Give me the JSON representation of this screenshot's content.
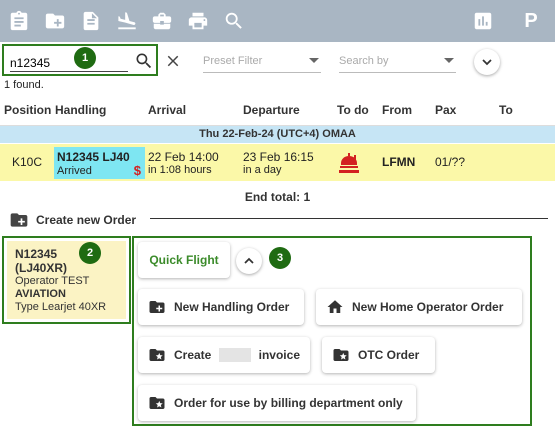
{
  "toolbar": {
    "icons": [
      "clipboard-icon",
      "add-folder-icon",
      "document-icon",
      "flight-landing-icon",
      "briefcase-icon",
      "print-icon",
      "search-icon",
      "bar-chart-icon",
      "parking-icon"
    ],
    "parking_label": "P"
  },
  "search": {
    "value": "n12345",
    "badge": "1"
  },
  "filters": {
    "preset_placeholder": "Preset Filter",
    "search_by_placeholder": "Search by"
  },
  "result": {
    "found_text": "1 found."
  },
  "table": {
    "headers": {
      "position": "Position",
      "handling": "Handling",
      "arrival": "Arrival",
      "departure": "Departure",
      "todo": "To do",
      "from": "From",
      "pax": "Pax",
      "to": "To"
    },
    "date_group": "Thu 22-Feb-24 (UTC+4) OMAA",
    "row": {
      "position": "K10C",
      "handling_title": "N12345 LJ40",
      "handling_status": "Arrived",
      "handling_flag": "$",
      "arrival_time": "22 Feb 14:00",
      "arrival_rel": "in 1:08 hours",
      "departure_time": "23 Feb 16:15",
      "departure_rel": "in a day",
      "from": "LFMN",
      "pax": "01/??"
    },
    "end_total": "End total: 1"
  },
  "create_order": {
    "label": "Create new Order"
  },
  "aircraft": {
    "badge": "2",
    "reg": "N12345",
    "type_code": "(LJ40XR)",
    "operator_line": "Operator TEST",
    "operator_line2": "AVIATION",
    "type_line": "Type Learjet 40XR"
  },
  "actions": {
    "badge": "3",
    "quick_flight": "Quick Flight",
    "new_handling_order": "New Handling Order",
    "new_home_operator_order": "New Home Operator Order",
    "create_prefix": "Create",
    "create_suffix": "invoice",
    "otc_order": "OTC Order",
    "billing_order": "Order for use by billing department only"
  },
  "colors": {
    "toolbar": "#a9b6c3",
    "highlight_green": "#2e7d1e",
    "date_row": "#c6e5f5",
    "row_yellow": "#fbf8a8",
    "handling_cyan": "#7ee6f2",
    "warning_red": "#d32020",
    "card_yellow": "#fbf3c4"
  }
}
